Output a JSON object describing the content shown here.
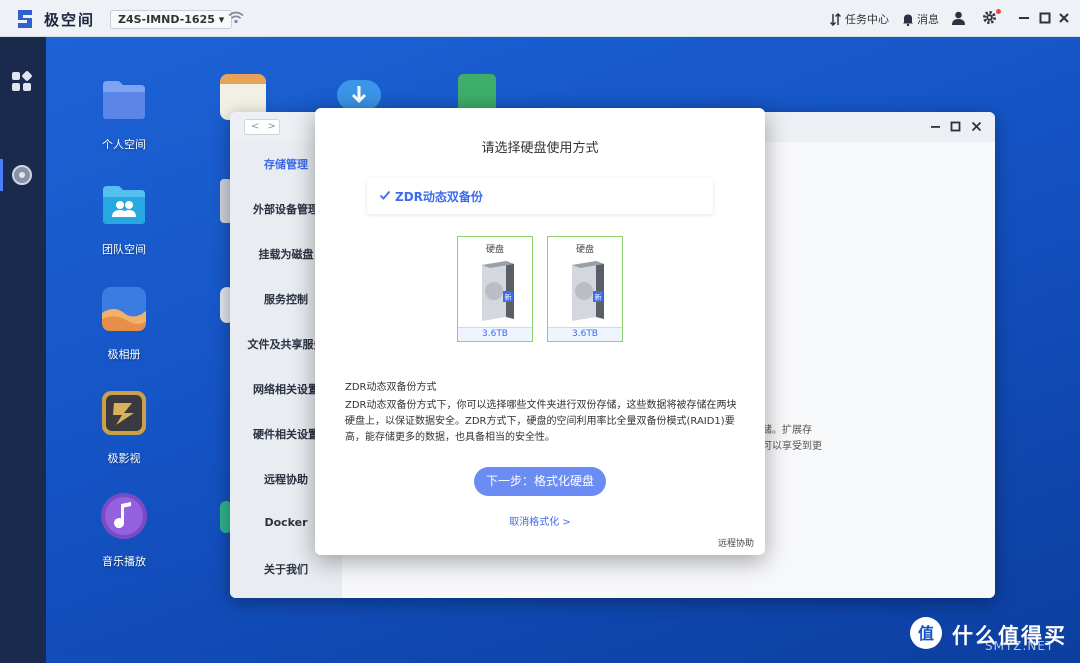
{
  "topbar": {
    "brand": "极空间",
    "device": "Z4S-IMND-1625 ▾",
    "tasks_label": "任务中心",
    "messages_label": "消息"
  },
  "desktop_icons": [
    {
      "label": "个人空间",
      "icon": "folder-icon",
      "color": "#5b86e8"
    },
    {
      "label": "团队空间",
      "icon": "team-folder-icon",
      "color": "#27a8e0"
    },
    {
      "label": "极相册",
      "icon": "photos-icon",
      "color": "#e7a35c"
    },
    {
      "label": "极影视",
      "icon": "video-icon",
      "color": "#c99a3a"
    },
    {
      "label": "音乐播放",
      "icon": "music-icon",
      "color": "#7a4bc4"
    }
  ],
  "window": {
    "sidebar": [
      {
        "label": "存储管理",
        "active": true
      },
      {
        "label": "外部设备管理"
      },
      {
        "label": "挂载为磁盘"
      },
      {
        "label": "服务控制"
      },
      {
        "label": "文件及共享服务"
      },
      {
        "label": "网络相关设置"
      },
      {
        "label": "硬件相关设置"
      },
      {
        "label": "远程协助"
      },
      {
        "label": "Docker"
      },
      {
        "label": "关于我们"
      }
    ],
    "content_fragments": [
      "储。扩展存",
      "可以享受到更"
    ]
  },
  "modal": {
    "title": "请选择硬盘使用方式",
    "mode_label": "ZDR动态双备份",
    "disks": [
      {
        "label": "硬盘",
        "badge": "新",
        "capacity": "3.6TB"
      },
      {
        "label": "硬盘",
        "badge": "新",
        "capacity": "3.6TB"
      }
    ],
    "description_title": "ZDR动态双备份方式",
    "description_body": "ZDR动态双备份方式下，你可以选择哪些文件夹进行双份存储，这些数据将被存储在两块硬盘上，以保证数据安全。ZDR方式下，硬盘的空间利用率比全量双备份模式(RAID1)要高，能存储更多的数据，也具备相当的安全性。",
    "next_button": "下一步：格式化硬盘",
    "cancel_link": "取消格式化 >",
    "remote_link": "远程协助"
  },
  "watermark": {
    "text": "什么值得买",
    "sub": "SMYZ.NET"
  },
  "colors": {
    "accent": "#3d6bea",
    "button": "#6b8cf2",
    "disk_border": "#8fd16a"
  }
}
